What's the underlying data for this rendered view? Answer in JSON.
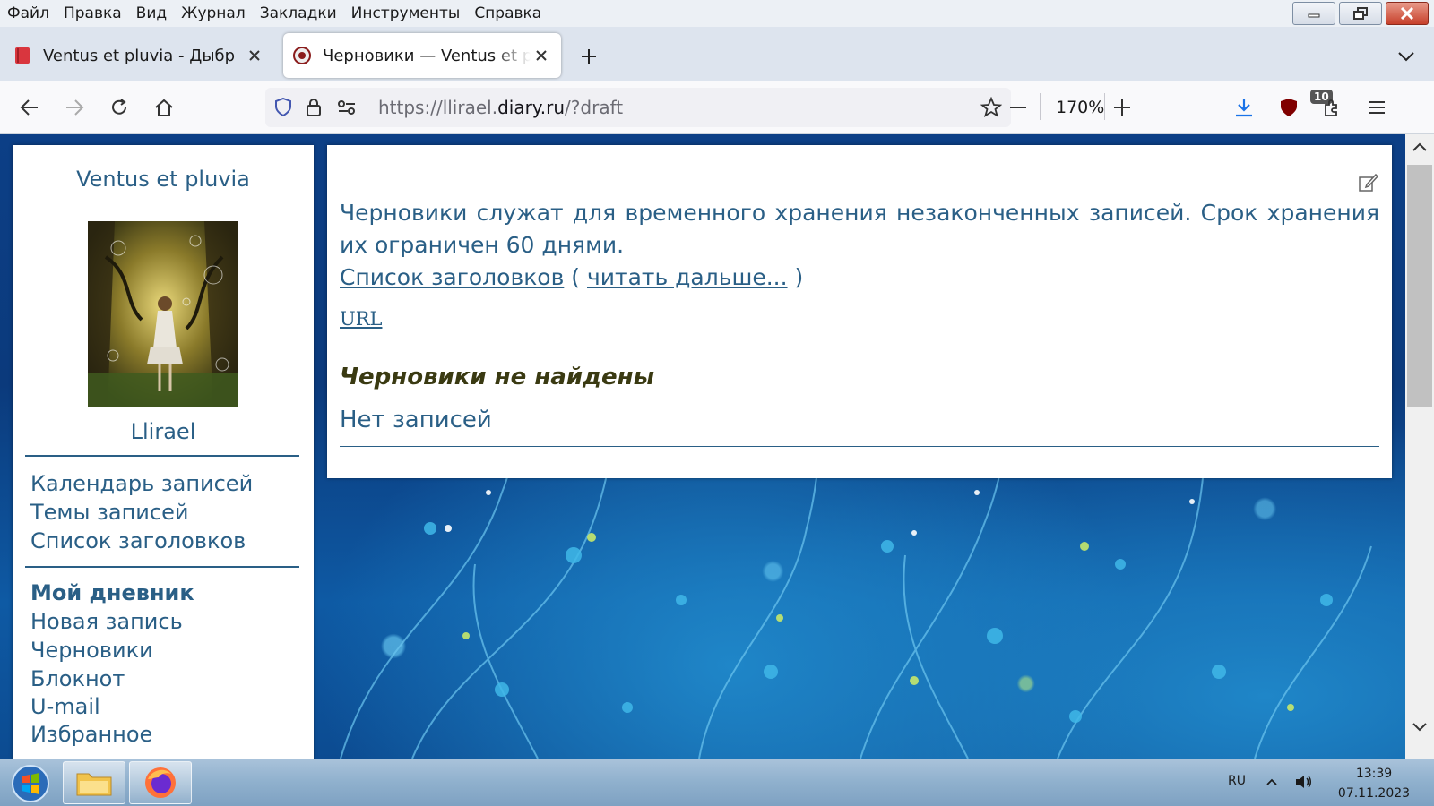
{
  "menubar": {
    "items": [
      "Файл",
      "Правка",
      "Вид",
      "Журнал",
      "Закладки",
      "Инструменты",
      "Справка"
    ]
  },
  "tabs": [
    {
      "title": "Ventus et pluvia - Дыбр",
      "active": false
    },
    {
      "title": "Черновики — Ventus et pluvia",
      "active": true
    }
  ],
  "navbar": {
    "url_prefix": "https://llirael.",
    "url_domain": "diary.ru",
    "url_suffix": "/?draft",
    "zoom": "170%",
    "extension_badge": "10"
  },
  "sidebar": {
    "blog_title": "Ventus et pluvia",
    "username": "Llirael",
    "links_top": [
      "Календарь записей",
      "Темы записей",
      "Список заголовков"
    ],
    "section_heading": "Мой дневник",
    "links_bottom": [
      "Новая запись",
      "Черновики",
      "Блокнот",
      "U-mail",
      "Избранное"
    ]
  },
  "content": {
    "intro": "Черновики служат для временного хранения незаконченных записей. Срок хранения их ограничен 60 днями.",
    "headlines_link": "Список заголовков",
    "open_paren": "(",
    "read_more_link": "читать дальше...",
    "close_paren": ")",
    "url_link": "URL",
    "not_found": "Черновики не найдены",
    "no_entries": "Нет записей"
  },
  "taskbar": {
    "language": "RU",
    "time": "13:39",
    "date": "07.11.2023"
  },
  "colors": {
    "link": "#2a5f86",
    "heading_dark": "#3a3a12",
    "page_bg": "#0c3f86",
    "taskbar": "#8fb0cd",
    "close_button": "#c7402b"
  }
}
